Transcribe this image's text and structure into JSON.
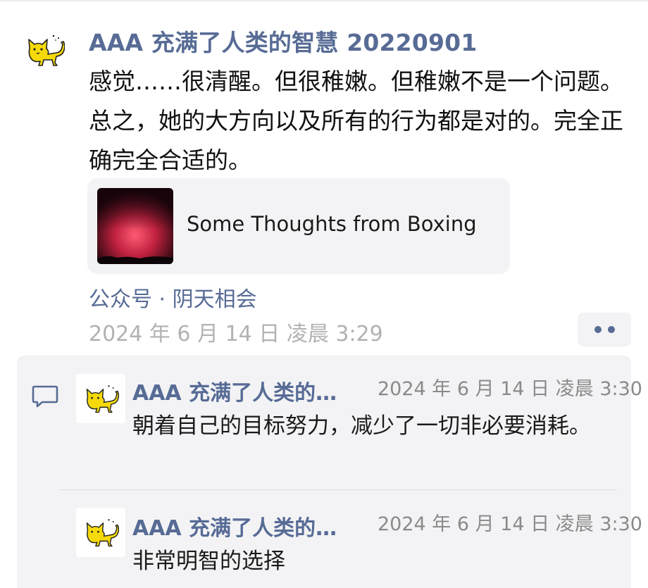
{
  "post": {
    "author": "AAA 充满了人类的智慧 20220901",
    "avatar_icon": "cat-icon",
    "text": "感觉……很清醒。但很稚嫩。但稚嫩不是一个问题。总之，她的大方向以及所有的行为都是对的。完全正确完全合适的。",
    "link_card": {
      "title": "Some Thoughts from Boxing",
      "thumbnail_icon": "aurora-thumbnail"
    },
    "source": "公众号 · 阴天相会",
    "time": "2024 年 6 月 14 日 凌晨 3:29",
    "more_icon": "more-dots-icon"
  },
  "comments_section": {
    "icon": "comment-icon",
    "comments": [
      {
        "author": "AAA 充满了人类的…",
        "time": "2024 年 6 月 14 日 凌晨 3:30",
        "text": "朝着自己的目标努力，减少了一切非必要消耗。"
      },
      {
        "author": "AAA 充满了人类的…",
        "time": "2024 年 6 月 14 日 凌晨 3:30",
        "text": "非常明智的选择"
      }
    ]
  },
  "colors": {
    "link_blue": "#576b95",
    "text": "#111111",
    "muted": "#b2b2b2",
    "panel": "#f3f3f5",
    "cat_yellow": "#f5d90a"
  }
}
